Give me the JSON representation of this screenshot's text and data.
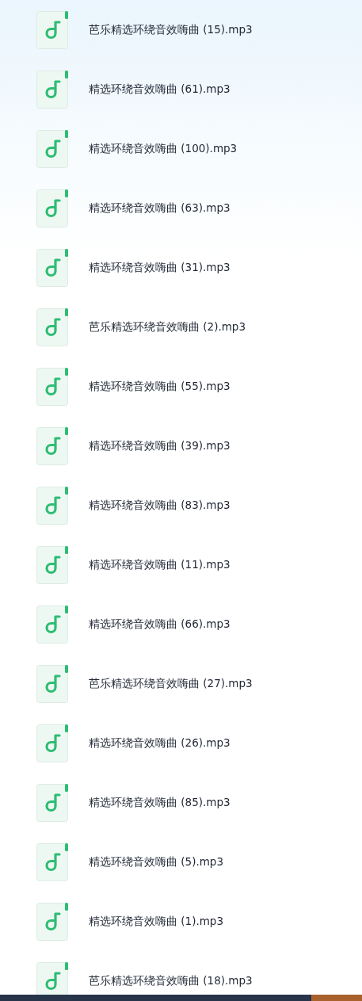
{
  "files": [
    {
      "name": "芭乐精选环绕音效嗨曲 (15).mp3"
    },
    {
      "name": "精选环绕音效嗨曲 (61).mp3"
    },
    {
      "name": "精选环绕音效嗨曲 (100).mp3"
    },
    {
      "name": "精选环绕音效嗨曲 (63).mp3"
    },
    {
      "name": "精选环绕音效嗨曲 (31).mp3"
    },
    {
      "name": "芭乐精选环绕音效嗨曲 (2).mp3"
    },
    {
      "name": "精选环绕音效嗨曲 (55).mp3"
    },
    {
      "name": "精选环绕音效嗨曲 (39).mp3"
    },
    {
      "name": "精选环绕音效嗨曲 (83).mp3"
    },
    {
      "name": "精选环绕音效嗨曲 (11).mp3"
    },
    {
      "name": "精选环绕音效嗨曲 (66).mp3"
    },
    {
      "name": "芭乐精选环绕音效嗨曲 (27).mp3"
    },
    {
      "name": "精选环绕音效嗨曲 (26).mp3"
    },
    {
      "name": "精选环绕音效嗨曲 (85).mp3"
    },
    {
      "name": "精选环绕音效嗨曲 (5).mp3"
    },
    {
      "name": "精选环绕音效嗨曲 (1).mp3"
    },
    {
      "name": "芭乐精选环绕音效嗨曲 (18).mp3"
    }
  ]
}
